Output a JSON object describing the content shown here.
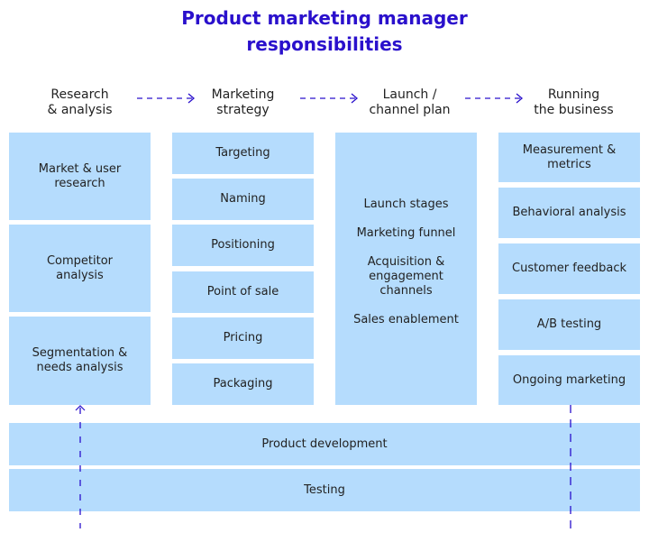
{
  "title": {
    "line1": "Product marketing manager",
    "line2": "responsibilities"
  },
  "accent_color": "#2a10cc",
  "box_color": "#b5dcfd",
  "columns": [
    {
      "header": {
        "line1": "Research",
        "line2": "& analysis"
      },
      "items": [
        {
          "line1": "Market & user",
          "line2": "research"
        },
        {
          "line1": "Competitor",
          "line2": "analysis"
        },
        {
          "line1": "Segmentation &",
          "line2": "needs analysis"
        }
      ]
    },
    {
      "header": {
        "line1": "Marketing",
        "line2": "strategy"
      },
      "items": [
        {
          "line1": "Targeting"
        },
        {
          "line1": "Naming"
        },
        {
          "line1": "Positioning"
        },
        {
          "line1": "Point of sale"
        },
        {
          "line1": "Pricing"
        },
        {
          "line1": "Packaging"
        }
      ]
    },
    {
      "header": {
        "line1": "Launch /",
        "line2": "channel plan"
      },
      "items": [
        {
          "line1": "Launch stages"
        },
        {
          "line1": "Marketing funnel"
        },
        {
          "line1": "Acquisition &",
          "line2": "engagement",
          "line3": "channels"
        },
        {
          "line1": "Sales enablement"
        }
      ]
    },
    {
      "header": {
        "line1": "Running",
        "line2": "the business"
      },
      "items": [
        {
          "line1": "Measurement &",
          "line2": "metrics"
        },
        {
          "line1": "Behavioral analysis"
        },
        {
          "line1": "Customer feedback"
        },
        {
          "line1": "A/B testing"
        },
        {
          "line1": "Ongoing marketing"
        }
      ]
    }
  ],
  "foundation": [
    {
      "label": "Product development"
    },
    {
      "label": "Testing"
    }
  ]
}
